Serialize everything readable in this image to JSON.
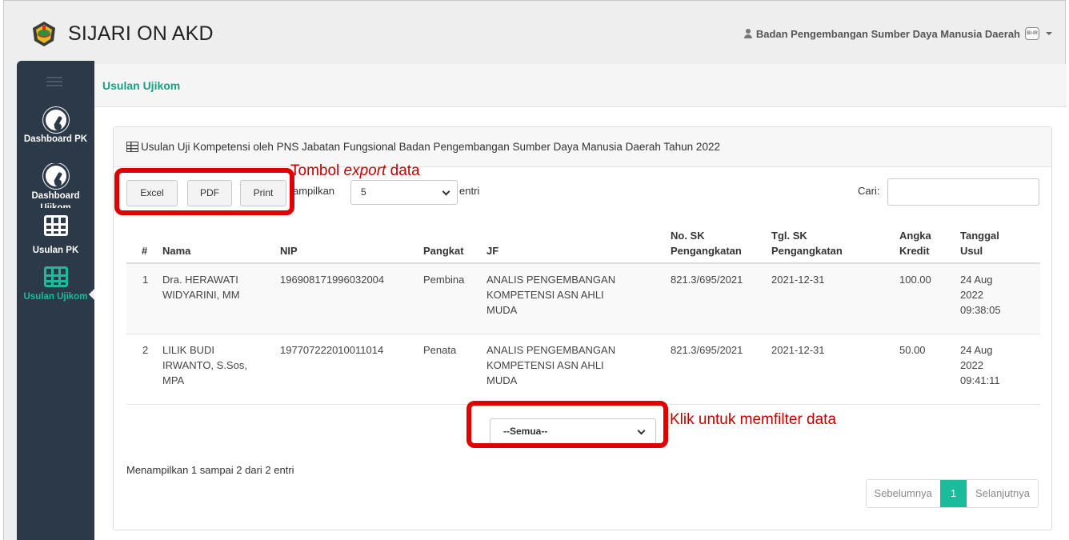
{
  "app": {
    "title": "SIJARI ON AKD",
    "logo_icon": "central-java-emblem-icon"
  },
  "user": {
    "name": "Badan Pengembangan Sumber Daya Manusia Daerah",
    "avatar_text": "BI-IR"
  },
  "sidebar": {
    "items": [
      {
        "label": "Dashboard PK",
        "icon": "gauge-icon"
      },
      {
        "label": "Dashboard Ujikom",
        "icon": "gauge-icon"
      },
      {
        "label": "Usulan PK",
        "icon": "table-icon"
      },
      {
        "label": "Usulan Ujikom",
        "icon": "table-icon",
        "active": true
      }
    ]
  },
  "page": {
    "title": "Usulan Ujikom"
  },
  "panel": {
    "title": "Usulan Uji Kompetensi oleh PNS Jabatan Fungsional Badan Pengembangan Sumber Daya Manusia Daerah Tahun 2022",
    "buttons": {
      "excel": "Excel",
      "pdf": "PDF",
      "print": "Print"
    },
    "length": {
      "prefix": "ampilkan",
      "value": "5",
      "suffix": "entri"
    },
    "search": {
      "label": "Cari:",
      "value": ""
    },
    "columns": [
      "#",
      "Nama",
      "NIP",
      "Pangkat",
      "JF",
      "No. SK",
      "Pengangkatan",
      "Tgl. SK",
      "Pengangkatan",
      "Angka",
      "Kredit",
      "Tanggal",
      "Usul"
    ],
    "rows": [
      {
        "no": "1",
        "nama1": "Dra. HERAWATI",
        "nama2": "WIDYARINI, MM",
        "nama3": "",
        "nip": "196908171996032004",
        "pangkat": "Pembina",
        "jf1": "ANALIS PENGEMBANGAN",
        "jf2": "KOMPETENSI ASN AHLI",
        "jf3": "MUDA",
        "no_sk": "821.3/695/2021",
        "tgl_sk": "2021-12-31",
        "angka": "100.00",
        "tgl1": "24 Aug",
        "tgl2": "2022",
        "tgl3": "09:38:05"
      },
      {
        "no": "2",
        "nama1": "LILIK BUDI",
        "nama2": "IRWANTO, S.Sos,",
        "nama3": "MPA",
        "nip": "197707222010011014",
        "pangkat": "Penata",
        "jf1": "ANALIS PENGEMBANGAN",
        "jf2": "KOMPETENSI ASN AHLI",
        "jf3": "MUDA",
        "no_sk": "821.3/695/2021",
        "tgl_sk": "2021-12-31",
        "angka": "50.00",
        "tgl1": "24 Aug",
        "tgl2": "2022",
        "tgl3": "09:41:11"
      }
    ],
    "filter": {
      "value": "--Semua--"
    },
    "info": "Menampilkan 1 sampai 2 dari 2 entri",
    "pagination": {
      "prev": "Sebelumnya",
      "current": "1",
      "next": "Selanjutnya"
    }
  },
  "annotations": {
    "export_prefix": "Tombol ",
    "export_em": "export",
    "export_suffix": " data",
    "filter": "Klik untuk memfilter data",
    "color": "#e00000"
  },
  "colors": {
    "accent": "#1abc9c",
    "sidebar": "#2b3948",
    "annotation": "#e00000"
  }
}
